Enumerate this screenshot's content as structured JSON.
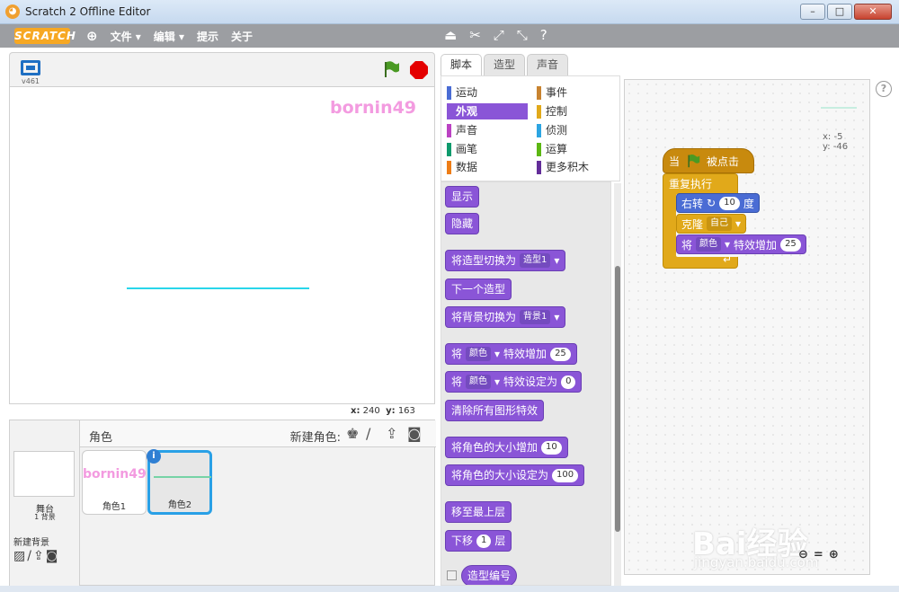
{
  "window": {
    "title": "Scratch 2 Offline Editor",
    "btn_min": "–",
    "btn_max": "□",
    "btn_close": "✕"
  },
  "menu": {
    "logo": "SCRATCH",
    "file": "文件 ▾",
    "edit": "编辑 ▾",
    "tips": "提示",
    "about": "关于"
  },
  "stage": {
    "version": "v461",
    "sprite_text": "bornin49",
    "x_label": "x:",
    "x_value": "240",
    "y_label": "y:",
    "y_value": "163"
  },
  "sprites": {
    "header": "角色",
    "new_sprite": "新建角色:",
    "stage_label": "舞台",
    "stage_count": "1 背景",
    "new_backdrop": "新建背景",
    "items": [
      {
        "name": "角色1",
        "thumb": "bornin49"
      },
      {
        "name": "角色2"
      }
    ]
  },
  "tabs": [
    "脚本",
    "造型",
    "声音"
  ],
  "categories": [
    {
      "label": "运动",
      "color": "#4a6cd4"
    },
    {
      "label": "事件",
      "color": "#c88330"
    },
    {
      "label": "外观",
      "color": "#8a55d7"
    },
    {
      "label": "控制",
      "color": "#e1a91a"
    },
    {
      "label": "声音",
      "color": "#bb42c3"
    },
    {
      "label": "侦测",
      "color": "#2ca5e2"
    },
    {
      "label": "画笔",
      "color": "#0e9a6c"
    },
    {
      "label": "运算",
      "color": "#5cb712"
    },
    {
      "label": "数据",
      "color": "#ee7d16"
    },
    {
      "label": "更多积木",
      "color": "#632d99"
    }
  ],
  "palette": {
    "show": "显示",
    "hide": "隐藏",
    "switch_costume": "将造型切换为",
    "costume1": "造型1",
    "next_costume": "下一个造型",
    "switch_backdrop": "将背景切换为",
    "backdrop1": "背景1",
    "change_effect_pre": "将",
    "effect_color": "颜色",
    "change_effect_post": "特效增加",
    "change_effect_val": "25",
    "set_effect_post": "特效设定为",
    "set_effect_val": "0",
    "clear_effects": "清除所有图形特效",
    "change_size": "将角色的大小增加",
    "change_size_val": "10",
    "set_size": "将角色的大小设定为",
    "set_size_val": "100",
    "go_front": "移至最上层",
    "go_back_pre": "下移",
    "go_back_val": "1",
    "go_back_post": "层",
    "costume_no": "造型编号"
  },
  "script": {
    "hat_pre": "当",
    "hat_post": "被点击",
    "forever": "重复执行",
    "turn_pre": "右转",
    "turn_val": "10",
    "turn_post": "度",
    "clone": "克隆",
    "clone_target": "自己",
    "effect_pre": "将",
    "effect": "颜色",
    "effect_post": "特效增加",
    "effect_val": "25",
    "x_label": "x: -5",
    "y_label": "y: -46"
  },
  "watermark": {
    "main": "Bai经验",
    "sub": "jingyan.baidu.com"
  },
  "colors": {
    "looks": "#8a55d7",
    "control": "#e1a91a",
    "event": "#c88a0e",
    "motion": "#4a6cd4"
  }
}
